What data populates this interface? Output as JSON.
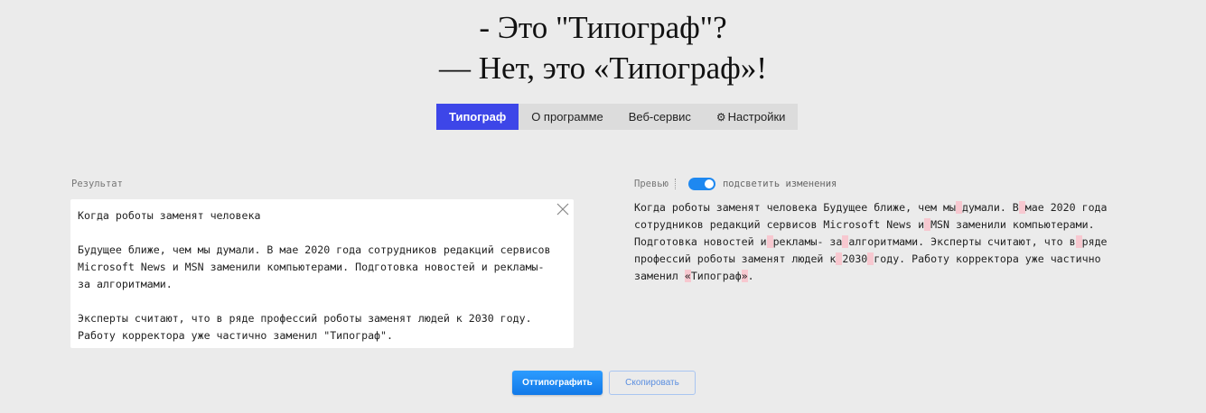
{
  "header": {
    "line1": "- Это \"Типограф\"?",
    "line2": "— Нет, это «Типограф»!"
  },
  "tabs": [
    {
      "label": "Типограф",
      "active": true
    },
    {
      "label": "О программе"
    },
    {
      "label": "Веб-сервис"
    },
    {
      "label": "Настройки",
      "icon": "gear-icon"
    }
  ],
  "result": {
    "label": "Результат",
    "text": "Когда роботы заменят человека\n\nБудущее ближе, чем мы думали. В мае 2020 года сотрудников редакций сервисов\nMicrosoft News и MSN заменили компьютерами. Подготовка новостей и рекламы-\nза алгоритмами.\n\nЭксперты считают, что в ряде профессий роботы заменят людей к 2030 году.\nРаботу корректора уже частично заменил \"Типограф\"."
  },
  "preview": {
    "label": "Превью",
    "toggle_label": "подсветить изменения",
    "toggle_on": true,
    "highlight_color": "#f7c8d0",
    "lines": [
      [
        "Когда роботы заменят человека Будущее ближе, чем мы",
        " ",
        "думали. В",
        " ",
        "мае 2020 года"
      ],
      [
        "сотрудников редакций сервисов Microsoft News и",
        " ",
        "MSN заменили компьютерами."
      ],
      [
        "Подготовка новостей и",
        " ",
        "рекламы- за",
        " ",
        "алгоритмами. Эксперты считают, что в",
        " ",
        "ряде"
      ],
      [
        "профессий роботы заменят людей к",
        " ",
        "2030",
        " ",
        "году. Работу корректора уже частично"
      ],
      [
        "заменил ",
        "«",
        "Типограф",
        "»",
        "."
      ]
    ]
  },
  "buttons": {
    "typograph": "Оттипографить",
    "copy": "Скопировать"
  },
  "colors": {
    "accent": "#3d46e8",
    "primary_button": "#1e88f0",
    "background": "#ebebeb"
  }
}
